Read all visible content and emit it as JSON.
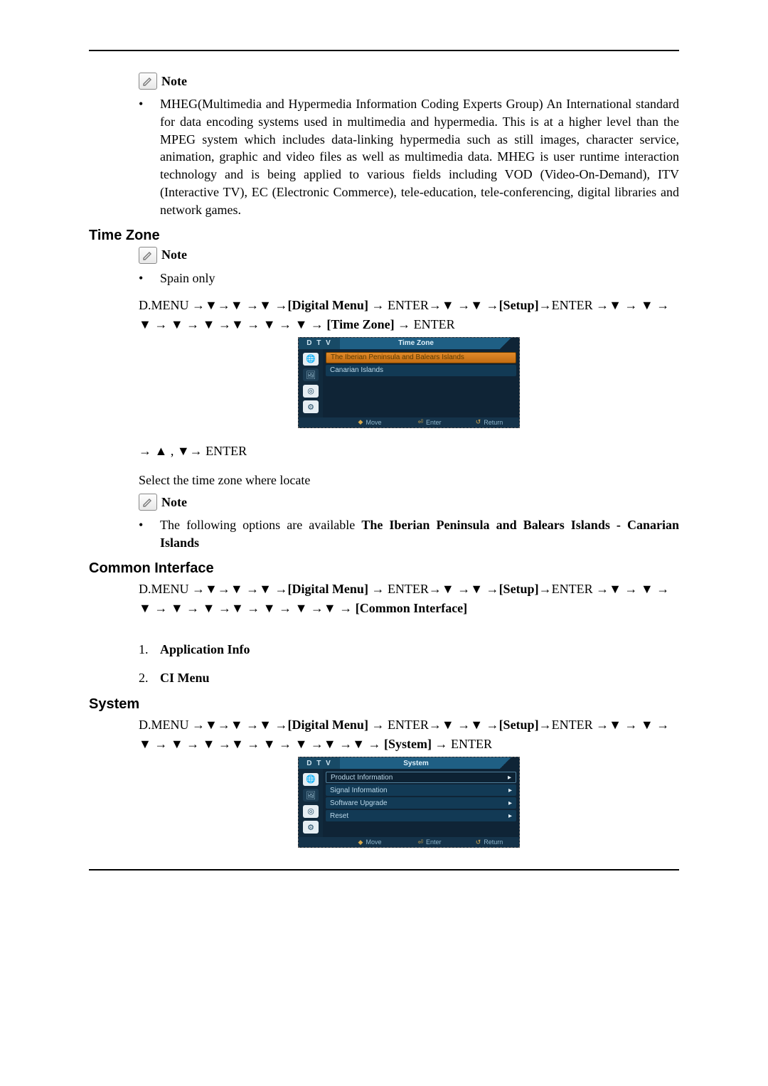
{
  "notes": {
    "label": "Note",
    "mheg": "MHEG(Multimedia and Hypermedia Information Coding Experts Group) An International standard for data encoding systems used in multimedia and hypermedia. This is at a higher level than the MPEG system which includes data-linking hypermedia such as still images, character service, animation, graphic and video files as well as multimedia data. MHEG is user runtime interaction technology and is being applied to various fields including VOD (Video-On-Demand), ITV (Interactive TV), EC (Electronic Commerce), tele-education, tele-conferencing, digital libraries and network games."
  },
  "timezone": {
    "heading": "Time Zone",
    "spain_only": "Spain only",
    "nav_prefix": "D.MENU →▼→▼ →▼ →",
    "digital_menu": "[Digital Menu]",
    "nav_mid1": " → ENTER→▼ →▼ →",
    "setup": "[Setup]",
    "nav_mid2": "→ENTER →▼ → ▼ → ▼ → ▼ → ▼ →▼ → ▼ → ▼ → ",
    "timezone_label": "[Time Zone]",
    "nav_tail": " → ENTER",
    "after_menu": "→ ▲ , ▼→ ENTER",
    "select_text": "Select the time zone where locate",
    "options_prefix": "The following options are available ",
    "options_bold": "The Iberian Peninsula and Balears Islands - Canarian Islands"
  },
  "timezone_osd": {
    "dtv": "D T V",
    "title": "Time Zone",
    "selected": "The Iberian Peninsula and Balears Islands",
    "row2": "Canarian Islands",
    "foot_move": "Move",
    "foot_enter": "Enter",
    "foot_return": "Return"
  },
  "common_interface": {
    "heading": "Common Interface",
    "nav_prefix": "D.MENU →▼→▼ →▼ →",
    "digital_menu": "[Digital Menu]",
    "nav_mid1": " → ENTER→▼ →▼ →",
    "setup": "[Setup]",
    "nav_mid2": "→ENTER →▼ → ▼ → ▼ → ▼ → ▼ →▼ → ▼ → ▼ →▼ → ",
    "ci_label": "[Common Interface]",
    "item1": "Application Info",
    "item2": "CI Menu"
  },
  "system": {
    "heading": "System",
    "nav_prefix": "D.MENU →▼→▼ →▼ →",
    "digital_menu": "[Digital Menu]",
    "nav_mid1": " → ENTER→▼ →▼ →",
    "setup": "[Setup]",
    "nav_mid2": "→ENTER →▼ → ▼ → ▼ → ▼ → ▼ →▼ → ▼ → ▼ →▼ →▼ → ",
    "system_label": "[System]",
    "nav_tail": " → ENTER"
  },
  "system_osd": {
    "dtv": "D T V",
    "title": "System",
    "rows": [
      "Product Information",
      "Signal Information",
      "Software Upgrade",
      "Reset"
    ],
    "foot_move": "Move",
    "foot_enter": "Enter",
    "foot_return": "Return"
  }
}
